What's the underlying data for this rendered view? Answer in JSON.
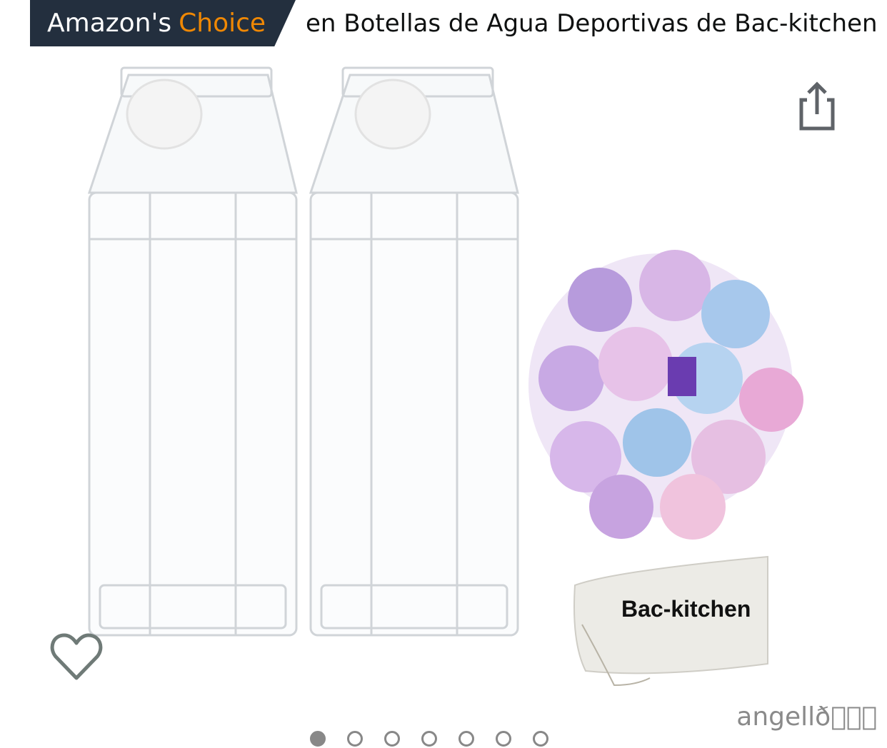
{
  "badge": {
    "brand": "Amazon's",
    "choice": "Choice",
    "suffix": "en Botellas de Agua Deportivas de Bac-kitchen"
  },
  "product": {
    "bag_print": "Bac-kitchen"
  },
  "watermark": "angellð\u0000\u0000\u0000",
  "carousel": {
    "count": 7,
    "active_index": 0
  },
  "icons": {
    "share": "share-icon",
    "wishlist": "heart-icon"
  },
  "colors": {
    "badge_bg": "#232f3e",
    "choice_accent": "#f08804"
  }
}
